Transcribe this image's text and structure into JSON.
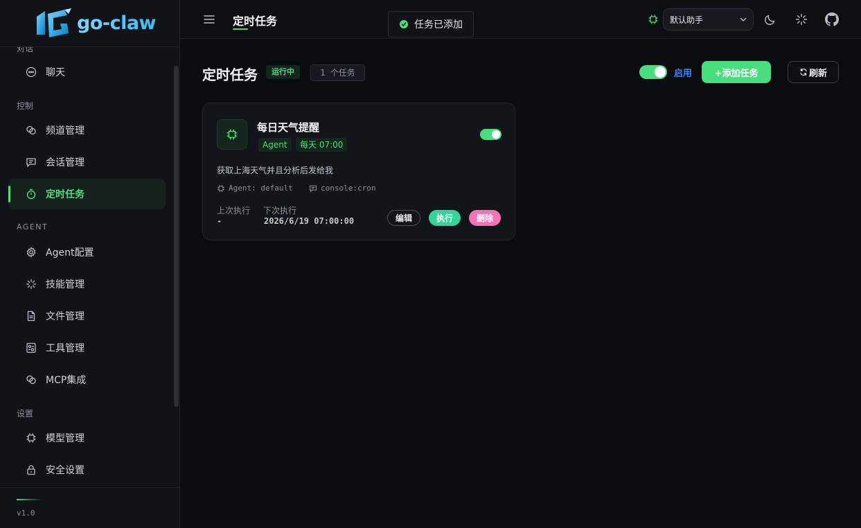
{
  "sidebar": {
    "brand": "go-claw",
    "sections": [
      {
        "title": "对话"
      },
      {
        "title": "控制"
      },
      {
        "title": "AGENT"
      },
      {
        "title": "设置"
      }
    ],
    "items": [
      {
        "label": "聊天",
        "icon": "chat-bubble-icon"
      },
      {
        "label": "频道管理",
        "icon": "link-icon"
      },
      {
        "label": "会话管理",
        "icon": "message-square-icon"
      },
      {
        "label": "定时任务",
        "icon": "timer-icon",
        "active": true
      },
      {
        "label": "Agent配置",
        "icon": "gear-icon"
      },
      {
        "label": "技能管理",
        "icon": "loader-icon"
      },
      {
        "label": "文件管理",
        "icon": "file-icon"
      },
      {
        "label": "工具管理",
        "icon": "wrench-card-icon"
      },
      {
        "label": "MCP集成",
        "icon": "link-icon"
      },
      {
        "label": "模型管理",
        "icon": "chip-icon"
      },
      {
        "label": "安全设置",
        "icon": "lock-icon"
      }
    ],
    "version": "v1.0"
  },
  "header": {
    "title": "定时任务",
    "toast": "任务已添加",
    "assistant_select": "默认助手"
  },
  "main": {
    "title": "定时任务",
    "status_badge": "运行中",
    "count_badge": "1 个任务",
    "enable_toggle": {
      "on": true,
      "label": "启用"
    },
    "add_button": "+添加任务",
    "refresh_button": "刷新"
  },
  "tasks": [
    {
      "name": "每日天气提醒",
      "tags": [
        "Agent",
        "每天 07:00"
      ],
      "enabled": true,
      "description": "获取上海天气并且分析后发给我",
      "agent": "Agent: default",
      "channel": "console:cron",
      "last_run_label": "上次执行",
      "last_run": "-",
      "next_run_label": "下次执行",
      "next_run": "2026/6/19 07:00:00",
      "actions": {
        "edit": "编辑",
        "run": "执行",
        "delete": "删除"
      }
    }
  ],
  "colors": {
    "accent": "#4ade80",
    "link": "#3b82f6",
    "run": "#34d399",
    "delete": "#f472b6",
    "background": "#0a0c10"
  }
}
